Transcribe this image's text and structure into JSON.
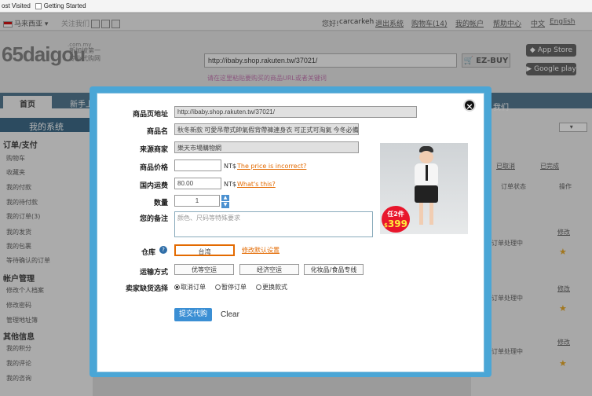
{
  "bookmarks": {
    "most_visited": "ost Visited",
    "getting_started": "Getting Started"
  },
  "topbar": {
    "region": "马来西亚",
    "follow": "关注我们",
    "greeting": "您好!",
    "username": "carcarkeh",
    "logout": "退出系统",
    "cart": "购物车(14)",
    "account": "我的帐户",
    "help": "帮助中心",
    "lang_cn": "中文",
    "lang_en": "English"
  },
  "header": {
    "logo": "65daigou",
    "logo_domain": ".com.my",
    "logo_sub1": "新加坡第一",
    "logo_sub2": "专业代购网",
    "url_value": "http://ibaby.shop.rakuten.tw/37021/",
    "ezbuy_label": "EZ-BUY",
    "url_hint": "请在这里粘贴要购买的商品URL或者关键词",
    "app_store": "App Store",
    "google_play": "Google play"
  },
  "nav": {
    "home": "首页",
    "beginner": "新手上"
  },
  "sidebar": {
    "title": "我的系统",
    "sections": [
      {
        "title": "订单/支付",
        "items": [
          "购物车",
          "收藏夹",
          "我的付款",
          "我的待付款",
          "我的订单(3)",
          "我的发货",
          "我的包裹",
          "等待确认的订单"
        ]
      },
      {
        "title": "帐户管理",
        "items": [
          "修改个人档案",
          "修改密码",
          "管理地址簿"
        ]
      },
      {
        "title": "其他信息",
        "items": [
          "我的积分",
          "我的评论",
          "我的咨询"
        ]
      }
    ]
  },
  "rightpanel": {
    "tab_text": "我们",
    "canceled": "已取消",
    "completed": "已完成",
    "order_status": "订单状态",
    "operation": "操作",
    "rows": [
      {
        "status": "订单处理中",
        "action": "修改"
      },
      {
        "status": "订单处理中",
        "action": "修改"
      },
      {
        "status": "订单处理中",
        "action": "修改"
      }
    ]
  },
  "modal": {
    "labels": {
      "url": "商品页地址",
      "name": "商品名",
      "merchant": "来源商家",
      "price": "商品价格",
      "shipping": "国内运费",
      "qty": "数量",
      "remark": "您的备注",
      "warehouse": "仓库",
      "transport": "运输方式",
      "seller_oos": "卖家缺货选择"
    },
    "url_value": "http://ibaby.shop.rakuten.tw/37021/",
    "name_value": "秋冬新款 可愛吊帶式帥氣假背帶褲連身衣 可正式可淘氣 今冬必備",
    "merchant_value": "樂天市場購物網",
    "price_value": "",
    "price_unit": "NT$",
    "price_link": "The price is incorrect?",
    "shipping_value": "80.00",
    "shipping_unit": "NT$",
    "shipping_link": "What's this?",
    "qty_value": "1",
    "remark_placeholder": "颜色、尺码等特殊要求",
    "warehouse_value": "台湾",
    "warehouse_link": "修改默认设置",
    "transport_options": [
      "优等空运",
      "经济空运",
      "化妆品/食品专线"
    ],
    "oos_options": [
      "取消订单",
      "暂停订单",
      "更换款式"
    ],
    "oos_selected": 0,
    "submit": "提交代购",
    "clear": "Clear",
    "promo_text": "任2件",
    "promo_price": "399"
  }
}
